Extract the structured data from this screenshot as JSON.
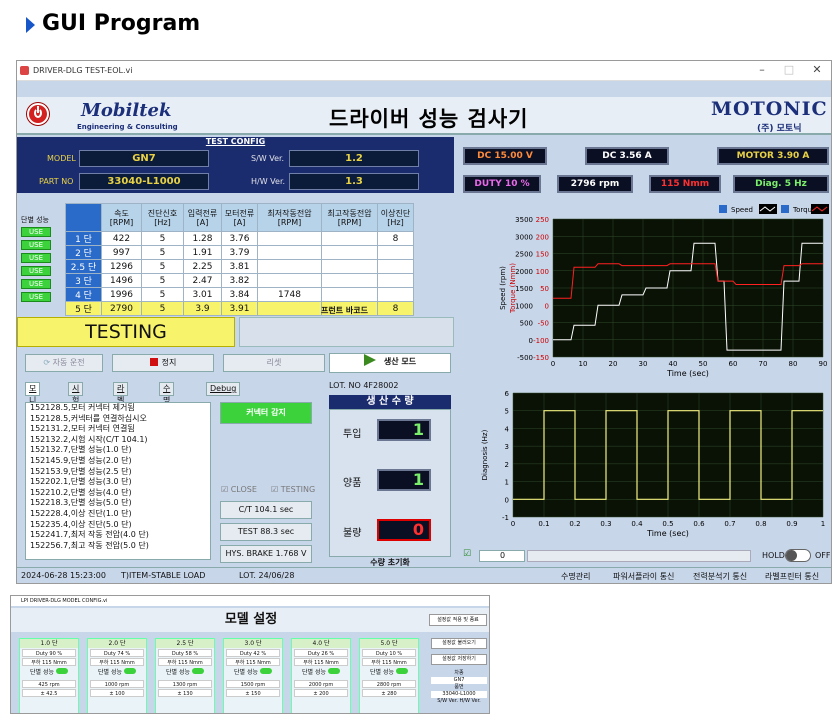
{
  "header": {
    "title": "GUI Program"
  },
  "window": {
    "title": "DRIVER-DLG TEST-EOL.vi",
    "min": "–",
    "max": "□",
    "close": "✕"
  },
  "banner": {
    "logo_left": "Mobiltek",
    "logo_left_sub": "Engineering & Consulting",
    "title": "드라이버 성능 검사기",
    "logo_right": "MOTONIC",
    "logo_right_sub": "(주) 모토닉"
  },
  "config": {
    "title": "TEST CONFIG",
    "model_label": "MODEL",
    "model": "GN7",
    "partno_label": "PART NO",
    "partno": "33040-L1000",
    "sw_label": "S/W Ver.",
    "sw": "1.2",
    "hw_label": "H/W Ver.",
    "hw": "1.3"
  },
  "meters": {
    "dc_v": "DC 15.00 V",
    "dc_a": "DC 3.56 A",
    "motor": "MOTOR 3.90 A",
    "duty": "DUTY 10 %",
    "rpm": "2796 rpm",
    "torque": "115 Nmm",
    "diag": "Diag. 5 Hz"
  },
  "table": {
    "side_label": "단별 성능",
    "use_label": "USE",
    "headers": [
      "",
      "속도\n[RPM]",
      "진단신호\n[Hz]",
      "입력전류\n[A]",
      "모터전류\n[A]",
      "최저작동전압\n[RPM]",
      "최고작동전압\n[RPM]",
      "이상진단\n[Hz]"
    ],
    "rows": [
      [
        "1 단",
        "422",
        "5",
        "1.28",
        "3.76",
        "",
        "",
        "8"
      ],
      [
        "2 단",
        "997",
        "5",
        "1.91",
        "3.79",
        "",
        "",
        ""
      ],
      [
        "2.5 단",
        "1296",
        "5",
        "2.25",
        "3.81",
        "",
        "",
        ""
      ],
      [
        "3 단",
        "1496",
        "5",
        "2.47",
        "3.82",
        "",
        "",
        ""
      ],
      [
        "4 단",
        "1996",
        "5",
        "3.01",
        "3.84",
        "1748",
        "",
        ""
      ],
      [
        "5 단",
        "2790",
        "5",
        "3.9",
        "3.91",
        "",
        "",
        "8"
      ]
    ]
  },
  "barcode_label": "프런트 바코드",
  "status_main": "TESTING",
  "buttons": {
    "auto": "자동 운전",
    "stop": "정지",
    "reset": "리셋",
    "prod_mode": "생산 모드",
    "connector": "커넥터 감지",
    "close": "CLOSE",
    "testing": "TESTING",
    "ct": "C/T 104.1 sec",
    "test": "TEST 88.3 sec",
    "brake": "HYS. BRAKE 1.768 V",
    "count_reset": "수량 초기화"
  },
  "tabs": [
    "모니터링",
    "시험 설정",
    "라벨 출력",
    "수명 관리",
    "Debug"
  ],
  "log": [
    "152128.5,모터 커넥터 제거됨",
    "152128.5,커넥터를 연결하십시오",
    "152131.2,모터 커넥터 연결됨",
    "152132.2,시험 시작(C/T 104.1)",
    "152132.7,단별 성능(1.0 단)",
    "152145.9,단별 성능(2.0 단)",
    "152153.9,단별 성능(2.5 단)",
    "152202.1,단별 성능(3.0 단)",
    "152210.2,단별 성능(4.0 단)",
    "152218.3,단별 성능(5.0 단)",
    "152228.4,이상 진단(1.0 단)",
    "152235.4,이상 진단(5.0 단)",
    "152241.7,최저 작동 전압(4.0 단)",
    "152256.7,최고 작동 전압(5.0 단)"
  ],
  "production": {
    "lot": "LOT. NO 4F28002",
    "title": "생 산 수 량",
    "input_label": "투입",
    "input": "1",
    "good_label": "양품",
    "good": "1",
    "bad_label": "불량",
    "bad": "0"
  },
  "chart1": {
    "legend_speed": "Speed",
    "legend_torque": "Torque",
    "xlabel": "Time (sec)",
    "ylabel_left": "Speed (rpm)",
    "ylabel_right": "Torque (Nmm)"
  },
  "chart2": {
    "xlabel": "Time (sec)",
    "ylabel": "Diagnosis (Hz)"
  },
  "chart_data": [
    {
      "type": "line",
      "xlabel": "Time (sec)",
      "ylabel": "Speed (rpm)",
      "xlim": [
        0,
        90
      ],
      "ylim": [
        -500,
        3500
      ],
      "ylim_right": [
        -150,
        250
      ],
      "x_ticks": [
        0,
        10,
        20,
        30,
        40,
        50,
        60,
        70,
        80,
        90
      ],
      "y_ticks": [
        -500,
        0,
        500,
        1000,
        1500,
        2000,
        2500,
        3000,
        3500
      ],
      "y_right_ticks": [
        -150,
        -100,
        -50,
        0,
        50,
        100,
        150,
        200,
        250
      ],
      "series": [
        {
          "name": "Speed",
          "color": "#ffffff",
          "x": [
            0,
            6,
            7,
            14,
            15,
            22,
            23,
            30,
            31,
            38,
            39,
            46,
            47,
            54,
            55,
            57,
            58,
            76,
            77,
            82,
            83,
            90
          ],
          "y": [
            0,
            0,
            420,
            420,
            1000,
            1000,
            1300,
            1300,
            1500,
            1500,
            2000,
            2000,
            2800,
            2800,
            1700,
            1700,
            -300,
            -300,
            1700,
            1700,
            2800,
            2800
          ]
        },
        {
          "name": "Torque",
          "color": "#ff2020",
          "x": [
            0,
            6,
            7,
            14,
            15,
            22,
            23,
            30,
            31,
            38,
            39,
            46,
            47,
            54,
            55,
            60,
            61,
            76,
            77,
            82,
            83,
            90
          ],
          "y": [
            20,
            20,
            110,
            110,
            120,
            120,
            115,
            115,
            115,
            115,
            120,
            120,
            120,
            120,
            70,
            70,
            60,
            60,
            115,
            115,
            120,
            120
          ]
        }
      ]
    },
    {
      "type": "line",
      "xlabel": "Time (sec)",
      "ylabel": "Diagnosis (Hz)",
      "xlim": [
        0,
        1
      ],
      "ylim": [
        -1,
        6
      ],
      "x_ticks": [
        0,
        0.1,
        0.2,
        0.3,
        0.4,
        0.5,
        0.6,
        0.7,
        0.8,
        0.9,
        1
      ],
      "y_ticks": [
        -1,
        0,
        1,
        2,
        3,
        4,
        5,
        6
      ],
      "series": [
        {
          "name": "",
          "color": "#f2f080",
          "x": [
            0,
            0.1,
            0.1,
            0.2,
            0.2,
            0.3,
            0.3,
            0.4,
            0.4,
            0.5,
            0.5,
            0.6,
            0.6,
            0.7,
            0.7,
            0.8,
            0.8,
            0.9,
            0.9,
            1.0
          ],
          "y": [
            0,
            0,
            5,
            5,
            0,
            0,
            5,
            5,
            0,
            0,
            5,
            5,
            0,
            0,
            5,
            5,
            0,
            0,
            5,
            5
          ]
        }
      ]
    }
  ],
  "chart_footer": {
    "value": "0",
    "hold": "HOLD",
    "off": "OFF"
  },
  "statusbar": {
    "time": "2024-06-28 15:23:00",
    "item": "T)ITEM-STABLE LOAD",
    "lot": "LOT. 24/06/28",
    "life": "수명관리",
    "power": "파워서플라이 통신",
    "analyzer": "전력분석기 통신",
    "printer": "라벨프린터 통신"
  },
  "panel2": {
    "title_bar": "LPI DRIVER-DLG MODEL CONFIG.vi",
    "title": "모델 설정",
    "save": "설정값 적용 및 종료",
    "load": "설정값 불러오기",
    "store": "설정값 저장하기",
    "cards": [
      {
        "step": "1.0 단",
        "duty": "Duty 90 %",
        "load": "부하 115 Nmm",
        "rpm": "425 rpm",
        "tol": "± 42.5"
      },
      {
        "step": "2.0 단",
        "duty": "Duty 74 %",
        "load": "부하 115 Nmm",
        "rpm": "1000 rpm",
        "tol": "± 100"
      },
      {
        "step": "2.5 단",
        "duty": "Duty 58 %",
        "load": "부하 115 Nmm",
        "rpm": "1300 rpm",
        "tol": "± 130"
      },
      {
        "step": "3.0 단",
        "duty": "Duty 42 %",
        "load": "부하 115 Nmm",
        "rpm": "1500 rpm",
        "tol": "± 150"
      },
      {
        "step": "4.0 단",
        "duty": "Duty 26 %",
        "load": "부하 115 Nmm",
        "rpm": "2000 rpm",
        "tol": "± 200"
      },
      {
        "step": "5.0 단",
        "duty": "Duty 10 %",
        "load": "부하 115 Nmm",
        "rpm": "2800 rpm",
        "tol": "± 280"
      }
    ],
    "perf": "단별 성능",
    "model_label": "차종",
    "model": "GN7",
    "part_label": "품번",
    "part": "33040-L1000",
    "sw_label": "S/W Ver.",
    "hw_label": "H/W Ver."
  }
}
